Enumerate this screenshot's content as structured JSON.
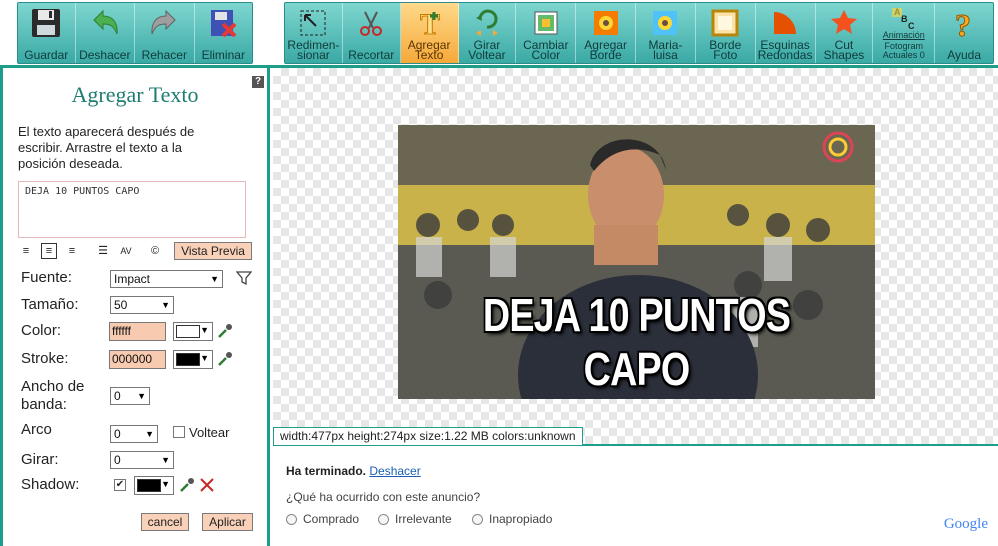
{
  "toolbar": {
    "file_buttons": [
      {
        "label": "Guardar"
      },
      {
        "label": "Deshacer"
      },
      {
        "label": "Rehacer"
      },
      {
        "label": "Eliminar"
      }
    ],
    "tools": [
      {
        "label": "Redimen-\nsionar"
      },
      {
        "label": "Recortar"
      },
      {
        "label": "Agregar\nTexto"
      },
      {
        "label": "Girar\nVoltear"
      },
      {
        "label": "Cambiar\nColor"
      },
      {
        "label": "Agregar\nBorde"
      },
      {
        "label": "Maria-\nluisa"
      },
      {
        "label": "Borde\nFoto"
      },
      {
        "label": "Esquinas\nRedondas"
      },
      {
        "label": "Cut\nShapes"
      },
      {
        "label": "Animación",
        "sub": "Fotogram\nActuales 0"
      },
      {
        "label": "Ayuda"
      }
    ],
    "active_tool": "Agregar\nTexto"
  },
  "panel": {
    "help": "?",
    "title": "Agregar Texto",
    "description": "El texto aparecerá después de escribir. Arrastre el texto a la posición deseada.",
    "text_value": "DEJA 10 PUNTOS CAPO",
    "preview_label": "Vista Previa",
    "copyright_glyph": "©",
    "font_label": "Fuente:",
    "font_value": "Impact",
    "size_label": "Tamaño:",
    "size_value": "50",
    "color_label": "Color:",
    "color_value": "ffffff",
    "stroke_label": "Stroke:",
    "stroke_value": "000000",
    "band_label": "Ancho de\nbanda:",
    "band_value": "0",
    "arc_label": "Arco",
    "arc_value": "0",
    "flip_label": "Voltear",
    "rotate_label": "Girar:",
    "rotate_value": "0",
    "shadow_label": "Shadow:",
    "cancel_label": "cancel",
    "apply_label": "Aplicar"
  },
  "canvas": {
    "caption": "DEJA 10 PUNTOS CAPO",
    "info": "width:477px  height:274px  size:1.22 MB  colors:unknown"
  },
  "ad": {
    "done_label": "Ha terminado.",
    "undo_label": "Deshacer",
    "question": "¿Qué ha ocurrido con este anuncio?",
    "options": [
      "Comprado",
      "Irrelevante",
      "Inapropiado"
    ],
    "brand": "Google"
  },
  "colors": {
    "toolbar_accent": "#3aa9a4",
    "active_tool": "#f6a93a",
    "panel_title": "#1e7d71",
    "input_bg": "#f8cbb1",
    "text_color": "#ffffff",
    "stroke_color": "#000000"
  }
}
